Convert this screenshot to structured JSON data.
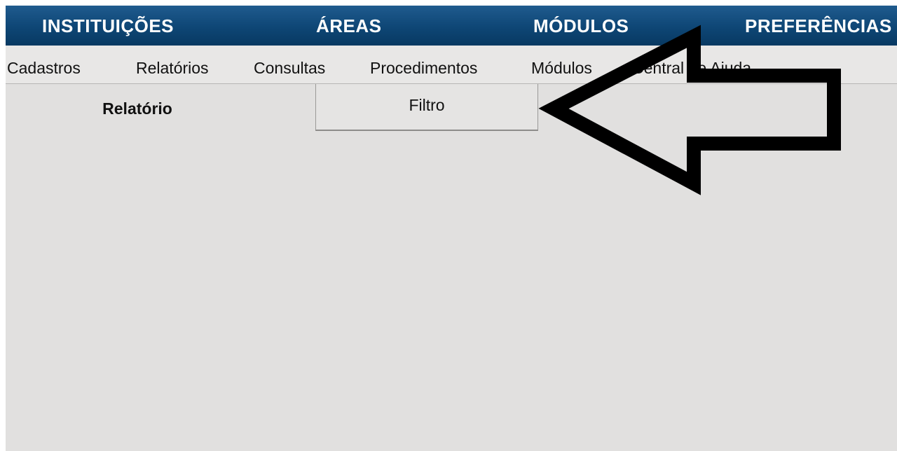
{
  "top_nav": {
    "items": [
      "INSTITUIÇÕES",
      "ÁREAS",
      "MÓDULOS",
      "PREFERÊNCIAS"
    ]
  },
  "menu_bar": {
    "items": [
      "Cadastros",
      "Relatórios",
      "Consultas",
      "Procedimentos",
      "Módulos",
      "Central de Ajuda"
    ]
  },
  "tabs": {
    "report_label": "Relatório",
    "filter_label": "Filtro"
  },
  "colors": {
    "nav_bg": "#0e4675",
    "content_bg": "#e1e0df",
    "annotation_arrow": "#000000"
  },
  "annotation": {
    "icon": "left-arrow-icon",
    "direction": "left"
  }
}
